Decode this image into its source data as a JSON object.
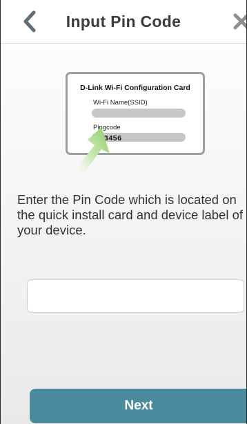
{
  "header": {
    "title": "Input Pin Code",
    "back_icon": "chevron-left-icon",
    "close_icon": "close-icon"
  },
  "card": {
    "title": "D-Link Wi-Fi Configuration Card",
    "ssid_label": "Wi-Fi Name(SSID)",
    "pin_label": "Pingcode",
    "pin_value": "123456"
  },
  "instructions": "Enter the Pin Code which is located on the quick install card and device label of your device.",
  "pin_input": {
    "value": "",
    "placeholder": ""
  },
  "next_button": {
    "label": "Next"
  },
  "colors": {
    "accent": "#4a8c9e",
    "arrow": "#8fce6a"
  }
}
